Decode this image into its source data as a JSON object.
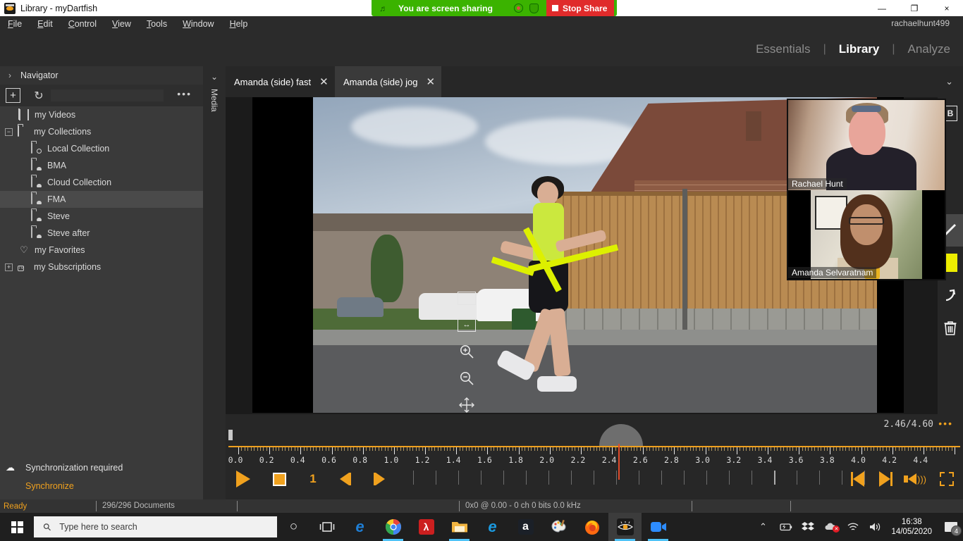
{
  "titlebar": {
    "title": "Library - myDartfish",
    "icon": "dartfish-eye-icon",
    "minimize": "—",
    "maximize": "❐",
    "close": "×"
  },
  "share_banner": {
    "flag_icon": "zoom-flag-icon",
    "text": "You are screen sharing",
    "record_icon": "record-dot-icon",
    "shield_icon": "shield-icon",
    "stop_label": "Stop Share"
  },
  "menubar": {
    "items": [
      "File",
      "Edit",
      "Control",
      "View",
      "Tools",
      "Window",
      "Help"
    ],
    "user": "rachaelhunt499"
  },
  "modules": [
    {
      "label": "Essentials",
      "active": false
    },
    {
      "label": "Library",
      "active": true
    },
    {
      "label": "Analyze",
      "active": false
    }
  ],
  "module_separator": "|",
  "sidebar": {
    "header": {
      "caret": "›",
      "title": "Navigator"
    },
    "toolbar": {
      "add": "+",
      "refresh": "↻",
      "more": "•••"
    },
    "tree": [
      {
        "label": "my Videos",
        "icon": "film-icon",
        "indent": 1,
        "expander": "",
        "selected": false
      },
      {
        "label": "my Collections",
        "icon": "folder-icon",
        "indent": 0,
        "expander": "−",
        "selected": false
      },
      {
        "label": "Local Collection",
        "icon": "local-collection-icon",
        "indent": 2,
        "expander": "",
        "selected": false
      },
      {
        "label": "BMA",
        "icon": "cloud-collection-icon",
        "indent": 2,
        "expander": "",
        "selected": false
      },
      {
        "label": "Cloud Collection",
        "icon": "cloud-collection-icon",
        "indent": 2,
        "expander": "",
        "selected": false
      },
      {
        "label": "FMA",
        "icon": "cloud-collection-icon",
        "indent": 2,
        "expander": "",
        "selected": true
      },
      {
        "label": "Steve",
        "icon": "cloud-collection-icon",
        "indent": 2,
        "expander": "",
        "selected": false
      },
      {
        "label": "Steve after",
        "icon": "cloud-collection-icon",
        "indent": 2,
        "expander": "",
        "selected": false
      },
      {
        "label": "my Favorites",
        "icon": "heart-icon",
        "indent": 1,
        "expander": "",
        "selected": false
      },
      {
        "label": "my Subscriptions",
        "icon": "tv-icon",
        "indent": 0,
        "expander": "+",
        "selected": false
      }
    ],
    "sync": {
      "icon": "cloud-check-icon",
      "status": "Synchronization required",
      "action": "Synchronize"
    }
  },
  "media_strip": {
    "caret": "⌄",
    "label": "Media"
  },
  "doc_tabs": {
    "tabs": [
      {
        "label": "Amanda (side) fast",
        "active": false,
        "close": "✕"
      },
      {
        "label": "Amanda (side) jog",
        "active": true,
        "close": "✕"
      }
    ],
    "overflow_caret": "⌄"
  },
  "video_tools": [
    {
      "name": "fit-height-icon",
      "glyph": "↕"
    },
    {
      "name": "fit-width-icon",
      "glyph": "↔"
    },
    {
      "name": "zoom-in-icon",
      "glyph": "🔍"
    },
    {
      "name": "zoom-out-icon",
      "glyph": "🔍"
    },
    {
      "name": "pan-icon",
      "glyph": "✥"
    }
  ],
  "right_tools": [
    {
      "name": "text-bold-tool",
      "label": "B"
    },
    {
      "name": "line-tool",
      "label": ""
    },
    {
      "name": "color-swatch-yellow",
      "label": "",
      "color": "#eded00"
    },
    {
      "name": "undo-tool",
      "label": "↶"
    },
    {
      "name": "delete-tool",
      "label": "🗑"
    },
    {
      "name": "snapshot-tool",
      "label": ""
    }
  ],
  "participants": [
    {
      "name": "Rachael Hunt"
    },
    {
      "name": "Amanda Selvaratnam"
    }
  ],
  "timeline": {
    "time_current": "2.46",
    "time_total": "4.60",
    "time_readout": "2.46/4.60",
    "more_dots": "•••",
    "tick_labels": [
      "0.0",
      "0.2",
      "0.4",
      "0.6",
      "0.8",
      "1.0",
      "1.2",
      "1.4",
      "1.6",
      "1.8",
      "2.0",
      "2.2",
      "2.4",
      "2.6",
      "2.8",
      "3.0",
      "3.2",
      "3.4",
      "3.6",
      "3.8",
      "4.0",
      "4.2",
      "4.4"
    ],
    "range_start": 0.0,
    "range_end": 4.6,
    "playhead": 2.46,
    "accent_color": "#f0a11e",
    "playhead_color": "#e04a2a"
  },
  "transport": {
    "play": "play-icon",
    "stop": "stop-icon",
    "speed": "1",
    "prev_frame": "prev-frame-icon",
    "next_frame": "next-frame-icon",
    "skip_start": "skip-to-start-icon",
    "skip_end": "skip-to-end-icon",
    "volume": "volume-icon",
    "fullscreen": "fullscreen-icon"
  },
  "statusbar": {
    "ready": "Ready",
    "documents": "296/296 Documents",
    "media_info": "0x0 @ 0.00  - 0 ch 0 bits 0.0 kHz"
  },
  "taskbar": {
    "start": "start-icon",
    "search_placeholder": "Type here to search",
    "apps": [
      {
        "name": "cortana-icon",
        "glyph": "○",
        "active": false,
        "underline": false
      },
      {
        "name": "task-view-icon",
        "glyph": "▣",
        "active": false,
        "underline": false
      },
      {
        "name": "edge-icon",
        "glyph": "e",
        "active": false,
        "underline": false
      },
      {
        "name": "chrome-icon",
        "glyph": "",
        "active": false,
        "underline": true
      },
      {
        "name": "acrobat-reader-icon",
        "glyph": "A",
        "active": false,
        "underline": false
      },
      {
        "name": "file-explorer-icon",
        "glyph": "",
        "active": false,
        "underline": true
      },
      {
        "name": "internet-explorer-icon",
        "glyph": "e",
        "active": false,
        "underline": false
      },
      {
        "name": "amazon-icon",
        "glyph": "a",
        "active": false,
        "underline": false
      },
      {
        "name": "paint-icon",
        "glyph": "",
        "active": false,
        "underline": false
      },
      {
        "name": "firefox-icon",
        "glyph": "",
        "active": false,
        "underline": false
      },
      {
        "name": "dartfish-icon",
        "glyph": "",
        "active": true,
        "underline": true
      },
      {
        "name": "zoom-icon",
        "glyph": "",
        "active": false,
        "underline": true
      }
    ],
    "tray": {
      "chevron": "⌃",
      "battery": "battery-charging-icon",
      "dropbox": "dropbox-icon",
      "onedrive": "onedrive-error-icon",
      "wifi": "wifi-icon",
      "volume": "volume-icon",
      "time": "16:38",
      "date": "14/05/2020",
      "notification_count": "4"
    }
  }
}
